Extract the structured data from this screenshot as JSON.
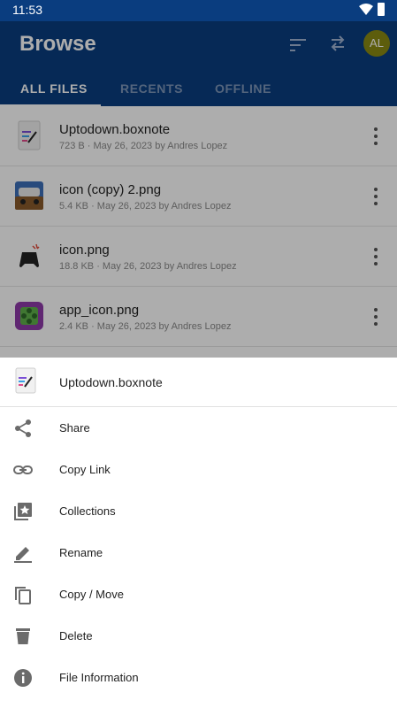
{
  "status_bar": {
    "time": "11:53"
  },
  "app_bar": {
    "title": "Browse",
    "avatar_initials": "AL",
    "tabs": [
      "ALL FILES",
      "RECENTS",
      "OFFLINE"
    ]
  },
  "files": [
    {
      "name": "Uptodown.boxnote",
      "meta": "723 B · May 26, 2023 by Andres Lopez"
    },
    {
      "name": "icon (copy) 2.png",
      "meta": "5.4 KB · May 26, 2023 by Andres Lopez"
    },
    {
      "name": "icon.png",
      "meta": "18.8 KB · May 26, 2023 by Andres Lopez"
    },
    {
      "name": "app_icon.png",
      "meta": "2.4 KB · May 26, 2023 by Andres Lopez"
    }
  ],
  "sheet": {
    "file_name": "Uptodown.boxnote",
    "actions": [
      "Share",
      "Copy Link",
      "Collections",
      "Rename",
      "Copy / Move",
      "Delete",
      "File Information"
    ]
  },
  "colors": {
    "brand": "#0a3d7f",
    "avatar": "#8a8a12",
    "icon": "#6b6b6b"
  }
}
